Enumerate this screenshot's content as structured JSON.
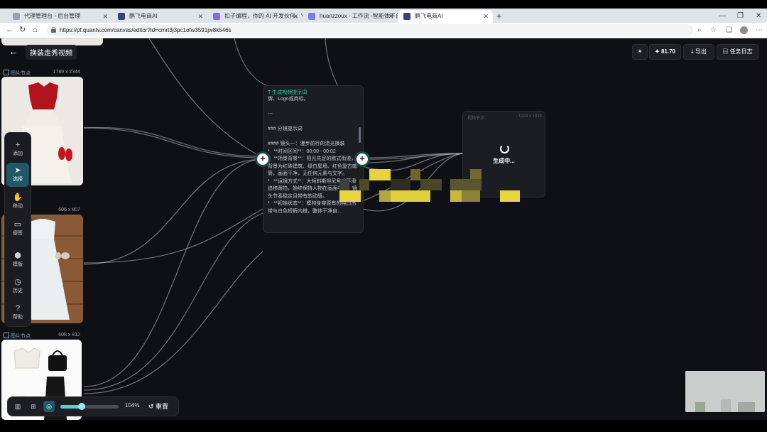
{
  "browser": {
    "tabs": [
      {
        "label": "代理管理台 - 后台管理",
        "active": false
      },
      {
        "label": "鹏飞电商AI",
        "active": false
      },
      {
        "label": "扣子编程，你的 AI 开发伙伴。V",
        "active": false
      },
      {
        "label": "huanzzoux - 工作流 -智能体平台",
        "active": false
      },
      {
        "label": "鹏飞电商AI",
        "active": true
      }
    ],
    "url": "https://pf.quantv.com/canvas/editor?id=cmrt3j3pc1ofw3591jw8k546s"
  },
  "canvas": {
    "title": "换装走秀视频",
    "nodes": [
      {
        "label": "图片节点",
        "size": "1789 x 2344"
      },
      {
        "label": "",
        "size": "606 x 807"
      },
      {
        "label": "图片节点",
        "size": "608 x 812"
      }
    ],
    "prompt_node": {
      "title": "生成视频提示词",
      "body": "牌、Logo或商标。\n\n---\n\n### 分镜提示词\n\n#### 镜头一：漫步前行的流光换装\n*   **时间区间**：00:00 - 00:02\n*   **场景背景**：阳光充足的欧式街道，背景为红砖建筑、绿白屋墙、红色复古邮筒，画面干净，无任何元素与文字。\n*   **运镜方式**：大倾斜斯坦尼角度平滑追移跟拍，始终保持人物在画面中央，镜头节奏稳定且带有韵动感。\n*   **初始状态**：模特身穿原有的纯白吊带与白色短裤内搭，整体干净自..."
    },
    "generation_node": {
      "label": "视频节点",
      "size": "1024 x 1024",
      "status": "生成中..."
    },
    "toolbar": [
      {
        "icon": "plus-icon",
        "label": "添加"
      },
      {
        "icon": "cursor-icon",
        "label": "选择",
        "selected": true
      },
      {
        "icon": "hand-icon",
        "label": "移动"
      },
      {
        "icon": "note-icon",
        "label": "便签"
      },
      {
        "icon": "cube-icon",
        "label": "模版"
      },
      {
        "icon": "clock-icon",
        "label": "历史"
      },
      {
        "icon": "help-icon",
        "label": "帮助"
      }
    ],
    "header_actions": {
      "credits": "81.70",
      "export_label": "导出",
      "tasklog_label": "任务日志"
    },
    "bottom": {
      "zoom": "104%",
      "zoom_level_fraction": 0.36,
      "reset_label": "重置"
    }
  },
  "colors": {
    "canvas_bg": "#0f1013",
    "accent": "#36d399",
    "port_ring": "#1a4b4d"
  }
}
